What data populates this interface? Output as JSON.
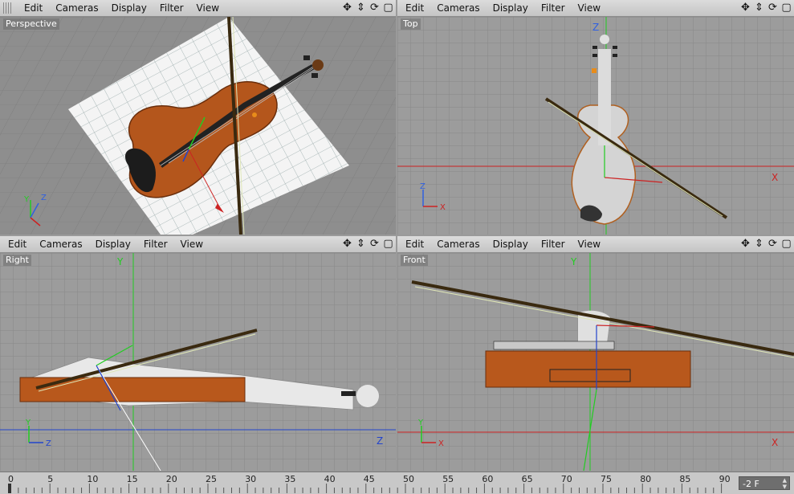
{
  "menu": [
    "Edit",
    "Cameras",
    "Display",
    "Filter",
    "View"
  ],
  "nav_icons": [
    "move-icon",
    "scale-icon",
    "rotate-icon",
    "maximize-icon"
  ],
  "viewports": {
    "perspective": {
      "label": "Perspective"
    },
    "top": {
      "label": "Top",
      "axis_v": "Z",
      "axis_h": "X"
    },
    "right": {
      "label": "Right",
      "axis_v": "Y",
      "axis_h": "Z"
    },
    "front": {
      "label": "Front",
      "axis_v": "Y",
      "axis_h": "X"
    }
  },
  "timeline": {
    "ticks": [
      "0",
      "5",
      "10",
      "15",
      "20",
      "25",
      "30",
      "35",
      "40",
      "45",
      "50",
      "55",
      "60",
      "65",
      "70",
      "75",
      "80",
      "85",
      "90"
    ],
    "current_frame": "-2 F"
  },
  "colors": {
    "viewport_bg": "#9c9c9c",
    "grid_line": "#8a8a8a",
    "axis_green": "#22cc22",
    "axis_red": "#cc2222",
    "violin_wood": "#b8581c",
    "bow_dark": "#5a3818"
  }
}
